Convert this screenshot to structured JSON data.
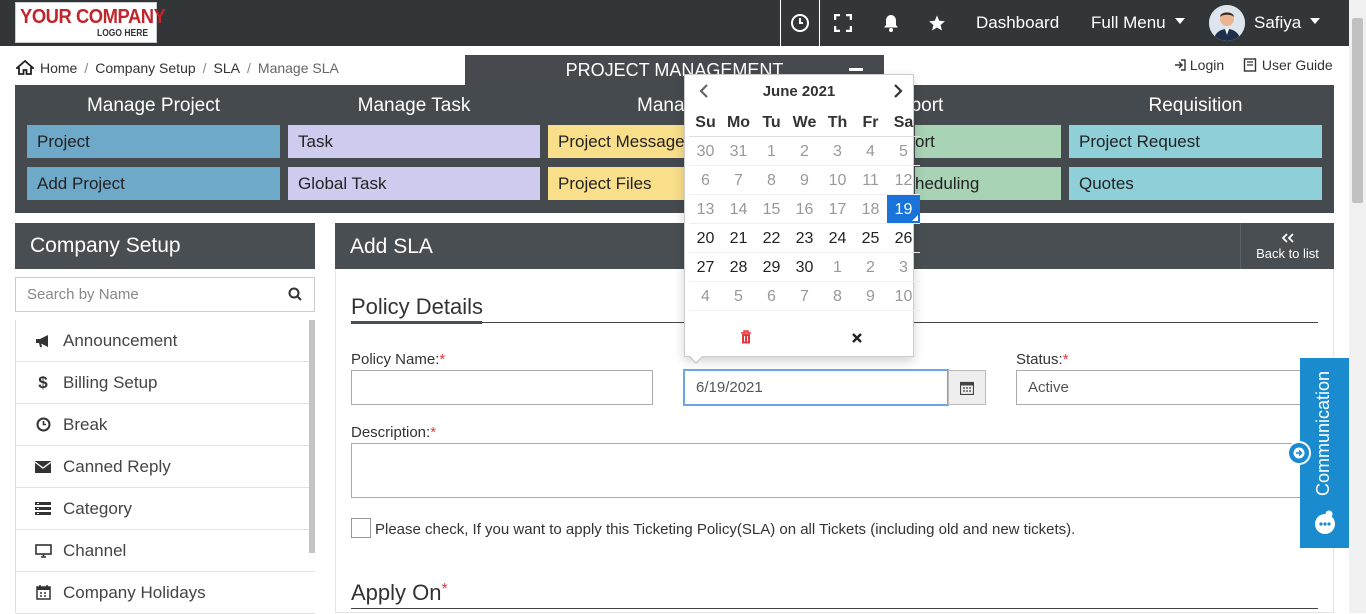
{
  "header": {
    "logo_line1": "YOUR COMPANY",
    "logo_line2": "LOGO HERE",
    "dashboard": "Dashboard",
    "full_menu": "Full Menu",
    "user_name": "Safiya"
  },
  "breadcrumb": [
    "Home",
    "Company Setup",
    "SLA",
    "Manage SLA"
  ],
  "project_management_bar": "PROJECT MANAGEMENT",
  "toplinks": {
    "login": "Login",
    "user_guide": "User Guide"
  },
  "menu": {
    "columns": [
      {
        "title": "Manage Project",
        "items": [
          "Project",
          "Add Project"
        ],
        "color": "#6fa9c9"
      },
      {
        "title": "Manage Task",
        "items": [
          "Task",
          "Global Task"
        ],
        "color": "#cfcbee"
      },
      {
        "title": "Manage",
        "items": [
          "Project Message",
          "Project Files"
        ],
        "color": "#f9df8a"
      },
      {
        "title": "eport",
        "items": [
          "ort",
          "heduling"
        ],
        "color": "#a8d3b4"
      },
      {
        "title": "Requisition",
        "items": [
          "Project Request",
          "Quotes"
        ],
        "color": "#8ecfd8"
      }
    ]
  },
  "sidebar": {
    "title": "Company Setup",
    "search_placeholder": "Search by Name",
    "items": [
      {
        "label": "Announcement",
        "icon": "megaphone-icon"
      },
      {
        "label": "Billing Setup",
        "icon": "dollar-icon"
      },
      {
        "label": "Break",
        "icon": "clock-icon"
      },
      {
        "label": "Canned Reply",
        "icon": "envelope-icon"
      },
      {
        "label": "Category",
        "icon": "category-icon"
      },
      {
        "label": "Channel",
        "icon": "monitor-icon"
      },
      {
        "label": "Company Holidays",
        "icon": "calendar-icon"
      }
    ]
  },
  "main": {
    "title": "Add SLA",
    "back_label": "Back to list",
    "section1": "Policy Details",
    "policy_name_label": "Policy Name:",
    "status_label": "Status:",
    "status_value": "Active",
    "date_value": "6/19/2021",
    "description_label": "Description:",
    "checkbox_label": "Please check, If you want to apply this Ticketing Policy(SLA) on all Tickets (including old and new tickets).",
    "section2": "Apply On",
    "required_mark": "*"
  },
  "communication": "Communication",
  "datepicker": {
    "month_label": "June 2021",
    "weekdays": [
      "Su",
      "Mo",
      "Tu",
      "We",
      "Th",
      "Fr",
      "Sa"
    ],
    "weeks": [
      [
        {
          "d": "30",
          "off": true
        },
        {
          "d": "31",
          "off": true
        },
        {
          "d": "1",
          "off": true
        },
        {
          "d": "2",
          "off": true
        },
        {
          "d": "3",
          "off": true
        },
        {
          "d": "4",
          "off": true
        },
        {
          "d": "5",
          "off": true
        }
      ],
      [
        {
          "d": "6",
          "off": true
        },
        {
          "d": "7",
          "off": true
        },
        {
          "d": "8",
          "off": true
        },
        {
          "d": "9",
          "off": true
        },
        {
          "d": "10",
          "off": true
        },
        {
          "d": "11",
          "off": true
        },
        {
          "d": "12",
          "off": true
        }
      ],
      [
        {
          "d": "13",
          "off": true
        },
        {
          "d": "14",
          "off": true
        },
        {
          "d": "15",
          "off": true
        },
        {
          "d": "16",
          "off": true
        },
        {
          "d": "17",
          "off": true
        },
        {
          "d": "18",
          "off": true
        },
        {
          "d": "19",
          "sel": true
        }
      ],
      [
        {
          "d": "20"
        },
        {
          "d": "21"
        },
        {
          "d": "22"
        },
        {
          "d": "23"
        },
        {
          "d": "24"
        },
        {
          "d": "25"
        },
        {
          "d": "26"
        }
      ],
      [
        {
          "d": "27"
        },
        {
          "d": "28"
        },
        {
          "d": "29"
        },
        {
          "d": "30"
        },
        {
          "d": "1",
          "off": true
        },
        {
          "d": "2",
          "off": true
        },
        {
          "d": "3",
          "off": true
        }
      ],
      [
        {
          "d": "4",
          "off": true
        },
        {
          "d": "5",
          "off": true
        },
        {
          "d": "6",
          "off": true
        },
        {
          "d": "7",
          "off": true
        },
        {
          "d": "8",
          "off": true
        },
        {
          "d": "9",
          "off": true
        },
        {
          "d": "10",
          "off": true
        }
      ]
    ]
  },
  "colors": {
    "accent": "#1a73d9",
    "topbar": "#333638",
    "communication": "#1a8bcf",
    "trash": "#e4393c"
  }
}
